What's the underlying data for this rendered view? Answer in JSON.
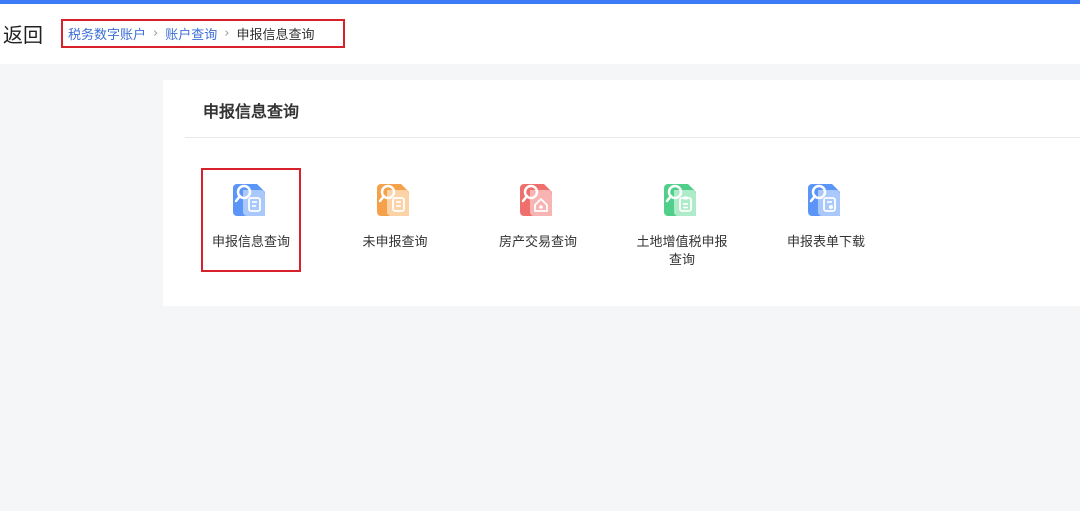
{
  "header": {
    "back_label": "返回",
    "breadcrumb": {
      "level1": "税务数字账户",
      "level2": "账户查询",
      "current": "申报信息查询"
    }
  },
  "panel": {
    "title": "申报信息查询",
    "tiles": [
      {
        "label": "申报信息查询",
        "icon": "declaration-query-icon",
        "color": "#4d8ef7",
        "selected": true
      },
      {
        "label": "未申报查询",
        "icon": "undeclared-query-icon",
        "color": "#f5a04a",
        "selected": false
      },
      {
        "label": "房产交易查询",
        "icon": "property-transaction-icon",
        "color": "#ef6f6c",
        "selected": false
      },
      {
        "label": "土地增值税申报查询",
        "icon": "land-tax-query-icon",
        "color": "#4fcf8a",
        "selected": false
      },
      {
        "label": "申报表单下载",
        "icon": "form-download-icon",
        "color": "#4d8ef7",
        "selected": false
      }
    ]
  },
  "colors": {
    "accent": "#3d7bf7",
    "highlight_border": "#d7222b",
    "link": "#3d6fd6"
  }
}
